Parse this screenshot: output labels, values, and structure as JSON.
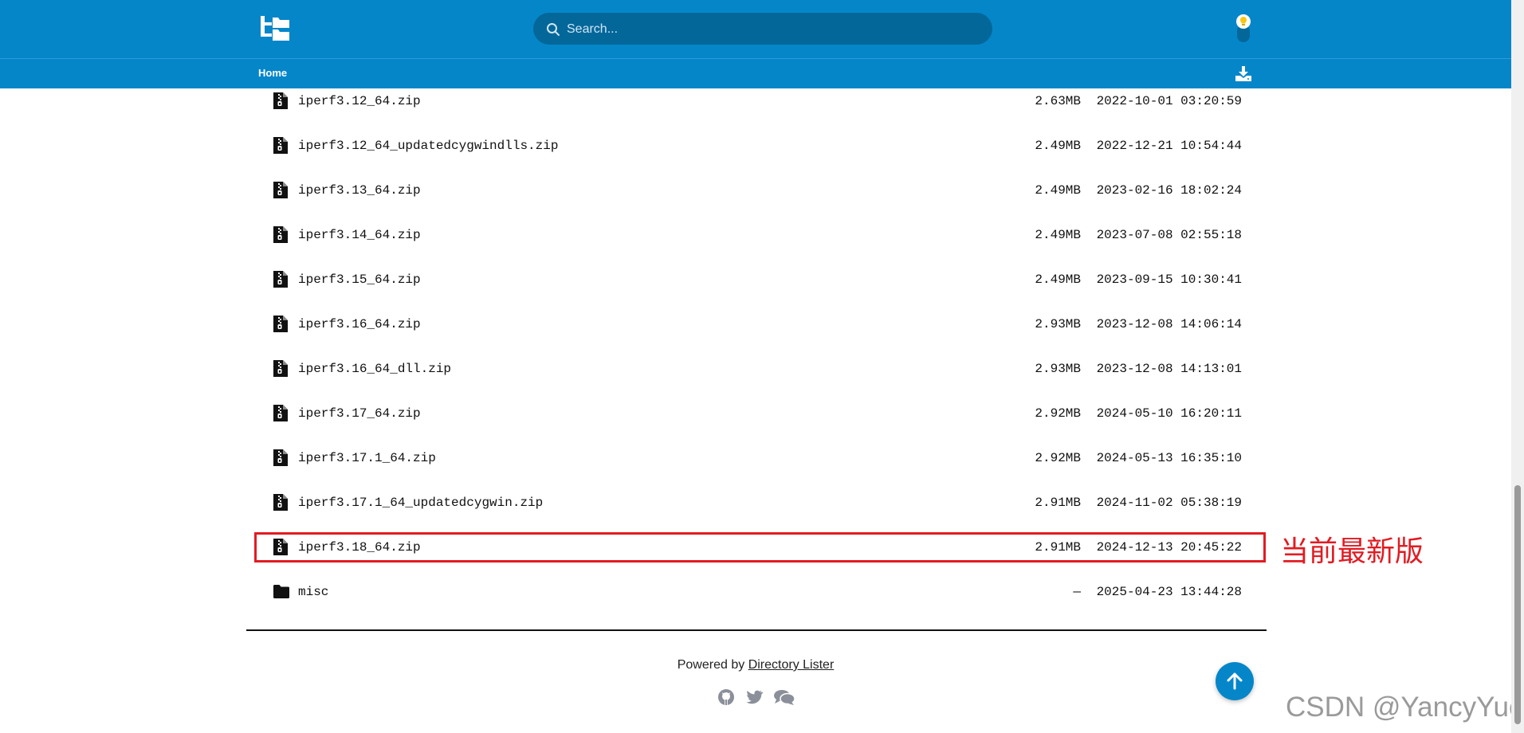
{
  "header": {
    "search_placeholder": "Search...",
    "logo_icon": "directory-lister-logo-icon",
    "theme_icon": "lightbulb-icon"
  },
  "nav": {
    "breadcrumb_home": "Home",
    "download_icon": "download-icon"
  },
  "files": [
    {
      "name": "iperf3.12_64.zip",
      "size": "2.63MB",
      "date": "2022-10-01 03:20:59",
      "icon": "zip-file-icon"
    },
    {
      "name": "iperf3.12_64_updatedcygwindlls.zip",
      "size": "2.49MB",
      "date": "2022-12-21 10:54:44",
      "icon": "zip-file-icon"
    },
    {
      "name": "iperf3.13_64.zip",
      "size": "2.49MB",
      "date": "2023-02-16 18:02:24",
      "icon": "zip-file-icon"
    },
    {
      "name": "iperf3.14_64.zip",
      "size": "2.49MB",
      "date": "2023-07-08 02:55:18",
      "icon": "zip-file-icon"
    },
    {
      "name": "iperf3.15_64.zip",
      "size": "2.49MB",
      "date": "2023-09-15 10:30:41",
      "icon": "zip-file-icon"
    },
    {
      "name": "iperf3.16_64.zip",
      "size": "2.93MB",
      "date": "2023-12-08 14:06:14",
      "icon": "zip-file-icon"
    },
    {
      "name": "iperf3.16_64_dll.zip",
      "size": "2.93MB",
      "date": "2023-12-08 14:13:01",
      "icon": "zip-file-icon"
    },
    {
      "name": "iperf3.17_64.zip",
      "size": "2.92MB",
      "date": "2024-05-10 16:20:11",
      "icon": "zip-file-icon"
    },
    {
      "name": "iperf3.17.1_64.zip",
      "size": "2.92MB",
      "date": "2024-05-13 16:35:10",
      "icon": "zip-file-icon"
    },
    {
      "name": "iperf3.17.1_64_updatedcygwin.zip",
      "size": "2.91MB",
      "date": "2024-11-02 05:38:19",
      "icon": "zip-file-icon"
    },
    {
      "name": "iperf3.18_64.zip",
      "size": "2.91MB",
      "date": "2024-12-13 20:45:22",
      "icon": "zip-file-icon"
    },
    {
      "name": "misc",
      "size": "—",
      "date": "2025-04-23 13:44:28",
      "icon": "folder-icon"
    }
  ],
  "annotation": {
    "text": "当前最新版",
    "color": "#e21b22"
  },
  "footer": {
    "powered_by": "Powered by",
    "link_text": "Directory Lister",
    "social_icons": [
      "github-icon",
      "twitter-icon",
      "chat-icon"
    ]
  },
  "watermark": "CSDN @YancyYue",
  "colors": {
    "brand": "#0586c9",
    "search_bg": "#04679a",
    "highlight": "#e21b22"
  }
}
